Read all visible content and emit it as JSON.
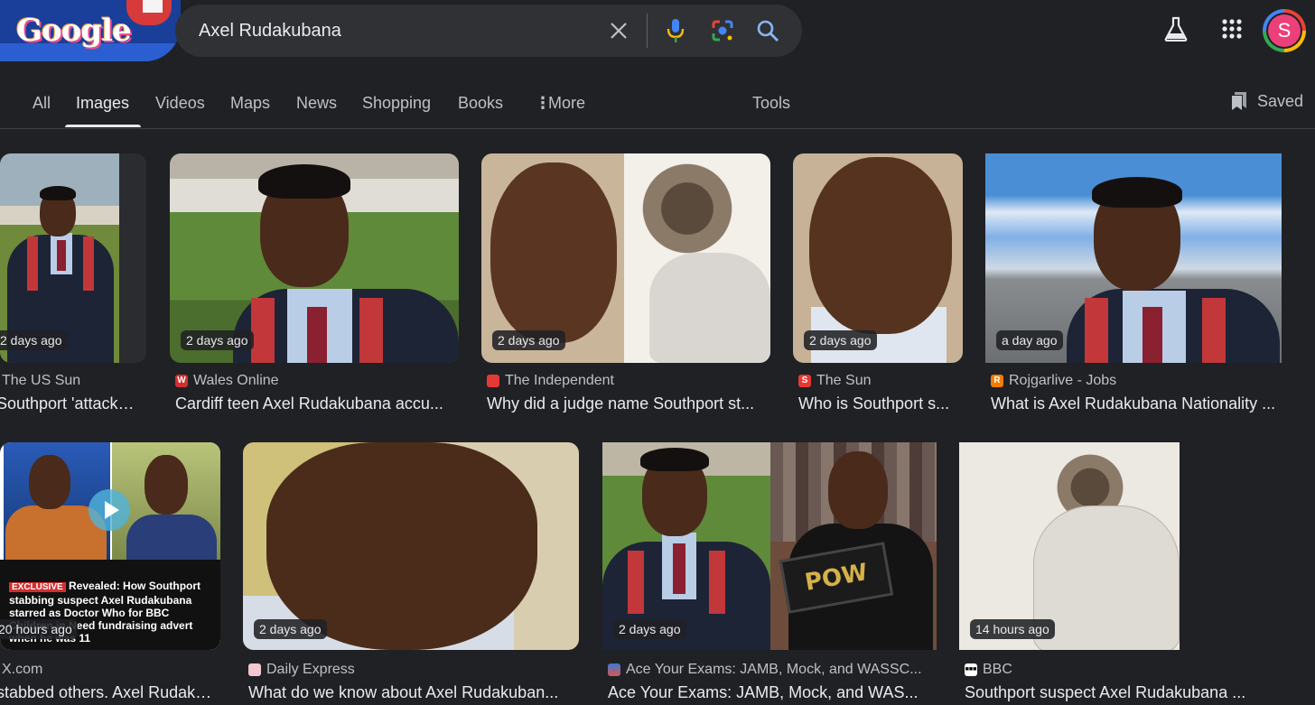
{
  "search": {
    "query": "Axel Rudakubana"
  },
  "logo": {
    "text": "Google"
  },
  "profile": {
    "initial": "S"
  },
  "tabs": [
    {
      "label": "All"
    },
    {
      "label": "Images"
    },
    {
      "label": "Videos"
    },
    {
      "label": "Maps"
    },
    {
      "label": "News"
    },
    {
      "label": "Shopping"
    },
    {
      "label": "Books"
    },
    {
      "label": "More"
    },
    {
      "label": "Tools"
    }
  ],
  "saved_label": "Saved",
  "results": [
    {
      "time": "2 days ago",
      "source": "The US Sun",
      "title": "Southport 'attacker..."
    },
    {
      "time": "2 days ago",
      "source": "Wales Online",
      "title": "Cardiff teen Axel Rudakubana accu..."
    },
    {
      "time": "2 days ago",
      "source": "The Independent",
      "title": "Why did a judge name Southport st..."
    },
    {
      "time": "2 days ago",
      "source": "The Sun",
      "title": "Who is Southport s..."
    },
    {
      "time": "a day ago",
      "source": "Rojgarlive - Jobs",
      "title": "What is Axel Rudakubana Nationality ..."
    },
    {
      "time": "20 hours ago",
      "source": "X.com",
      "title": "stabbed others. Axel Rudaku...",
      "overlay": {
        "tag": "EXCLUSIVE",
        "line1": "Revealed: How Southport",
        "line2": "stabbing suspect Axel Rudakubana",
        "line3": "starred as Doctor Who for BBC",
        "line4": "Children in Need fundraising advert",
        "line5": "when he was 11"
      }
    },
    {
      "time": "2 days ago",
      "source": "Daily Express",
      "title": "What do we know about Axel Rudakuban..."
    },
    {
      "time": "2 days ago",
      "source": "Ace Your Exams: JAMB, Mock, and WASSC...",
      "title": "Ace Your Exams: JAMB, Mock, and WAS...",
      "sign_text": "POW"
    },
    {
      "time": "14 hours ago",
      "source": "BBC",
      "title": "Southport suspect Axel Rudakubana ..."
    }
  ]
}
